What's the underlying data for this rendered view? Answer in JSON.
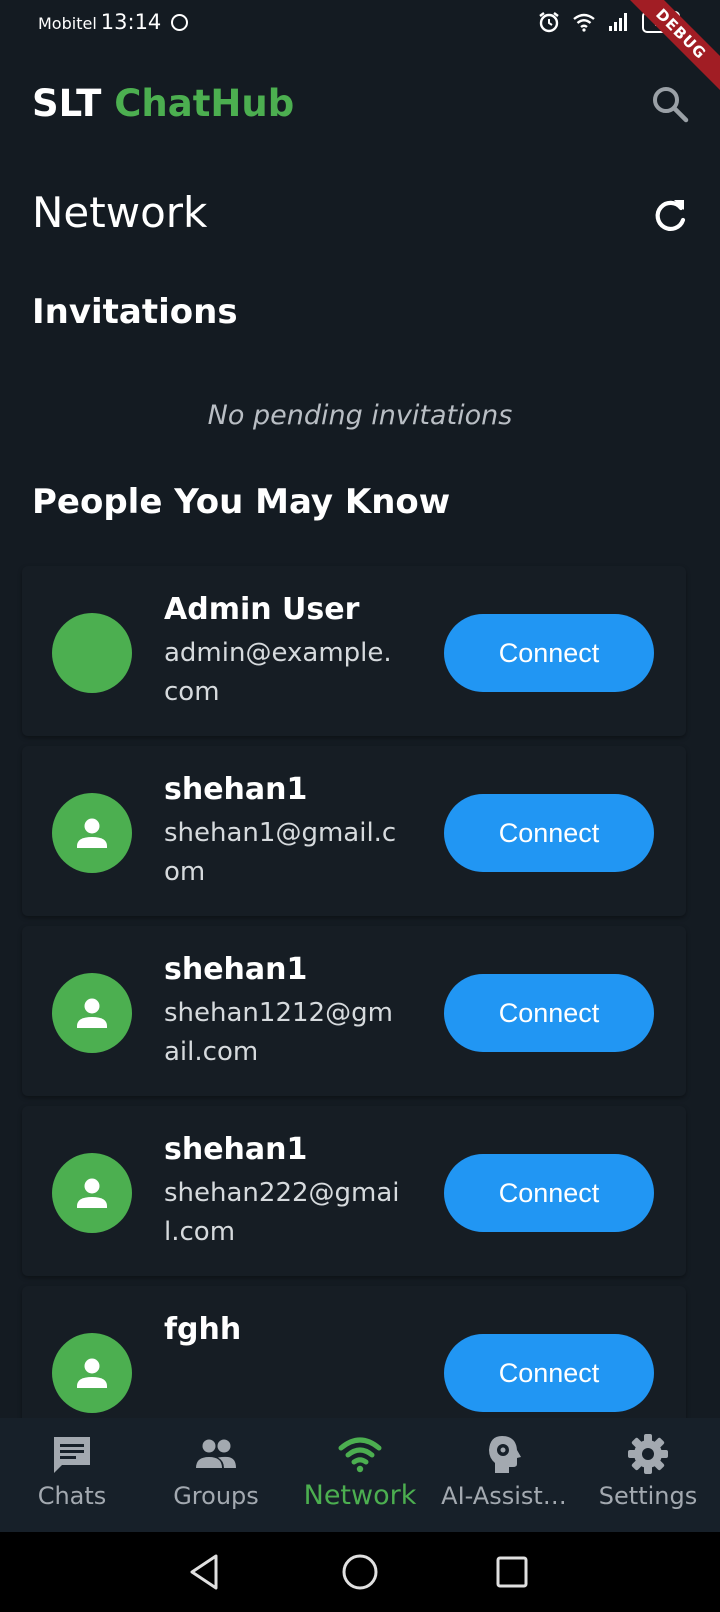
{
  "status_bar": {
    "carrier": "Mobitel",
    "time": "13:14",
    "battery": "72",
    "debug_label": "DEBUG"
  },
  "app_bar": {
    "title_part1": "SLT",
    "title_part2": "ChatHub",
    "search_icon": "search-icon"
  },
  "page": {
    "title": "Network",
    "refresh_icon": "refresh-icon"
  },
  "invitations": {
    "heading": "Invitations",
    "empty_text": "No pending invitations"
  },
  "people": {
    "heading": "People You May Know",
    "items": [
      {
        "name": "Admin User",
        "email": "admin@example.com",
        "button": "Connect",
        "avatar_icon": "none"
      },
      {
        "name": "shehan1",
        "email": "shehan1@gmail.com",
        "button": "Connect",
        "avatar_icon": "person-icon"
      },
      {
        "name": "shehan1",
        "email": "shehan1212@gmail.com",
        "button": "Connect",
        "avatar_icon": "person-icon"
      },
      {
        "name": "shehan1",
        "email": "shehan222@gmail.com",
        "button": "Connect",
        "avatar_icon": "person-icon"
      },
      {
        "name": "fghh",
        "email": "",
        "button": "Connect",
        "avatar_icon": "person-icon"
      }
    ]
  },
  "bottom_nav": {
    "items": [
      {
        "label": "Chats",
        "icon": "chat-icon",
        "active": false
      },
      {
        "label": "Groups",
        "icon": "groups-icon",
        "active": false
      },
      {
        "label": "Network",
        "icon": "wifi-icon",
        "active": true
      },
      {
        "label": "AI-Assist…",
        "icon": "ai-head-icon",
        "active": false
      },
      {
        "label": "Settings",
        "icon": "gear-icon",
        "active": false
      }
    ]
  },
  "colors": {
    "background": "#141b22",
    "accent_green": "#4caf50",
    "button_blue": "#2196f3",
    "nav_background": "#172029"
  }
}
